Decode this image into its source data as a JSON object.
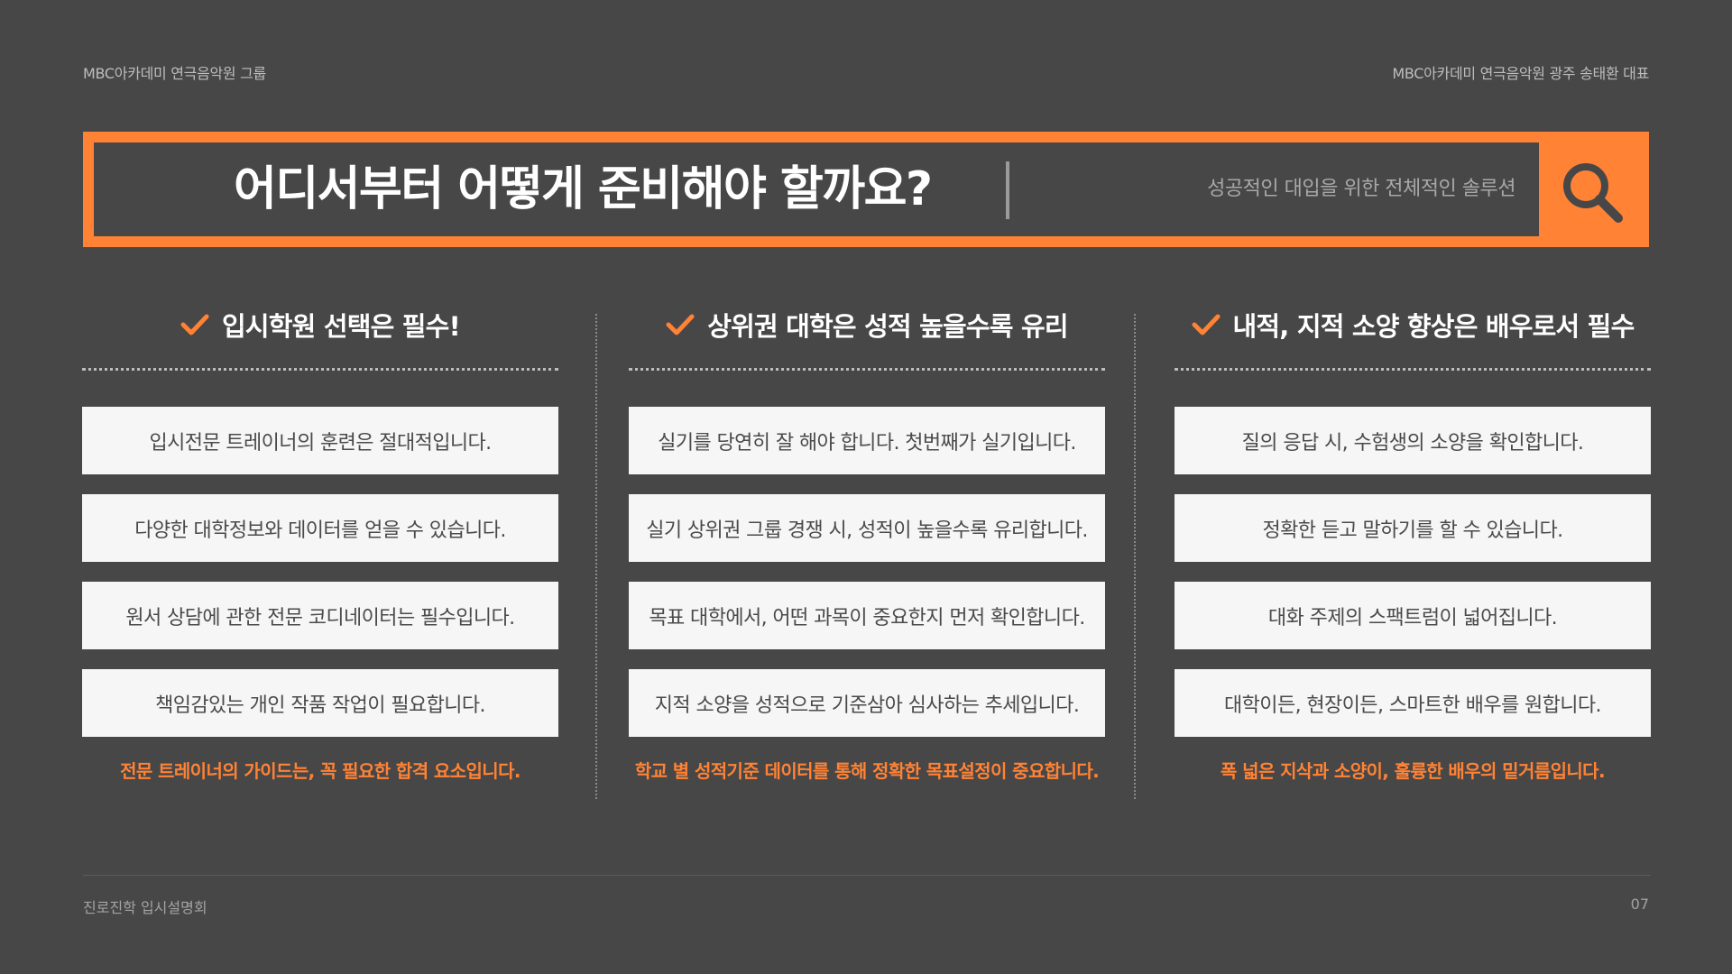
{
  "header": {
    "left_text": "MBC아카데미 연극음악원 그룹",
    "right_text": "MBC아카데미 연극음악원 광주 송태환 대표"
  },
  "search": {
    "query": "어디서부터 어떻게 준비해야 할까요?",
    "hint": "성공적인 대입을 위한 전체적인 솔루션",
    "icon": "search-icon"
  },
  "columns": [
    {
      "title": "입시학원 선택은 필수!",
      "items": [
        "입시전문 트레이너의 훈련은 절대적입니다.",
        "다양한 대학정보와 데이터를 얻을 수 있습니다.",
        "원서 상담에 관한 전문 코디네이터는 필수입니다.",
        "책임감있는 개인 작품 작업이 필요합니다."
      ],
      "note": "전문 트레이너의 가이드는, 꼭 필요한 합격 요소입니다."
    },
    {
      "title": "상위권 대학은 성적 높을수록 유리",
      "items": [
        "실기를 당연히 잘 해야 합니다. 첫번째가 실기입니다.",
        "실기 상위권 그룹 경쟁 시, 성적이 높을수록 유리합니다.",
        "목표 대학에서, 어떤 과목이 중요한지 먼저 확인합니다.",
        "지적 소양을 성적으로 기준삼아 심사하는 추세입니다."
      ],
      "note": "학교 별 성적기준 데이터를 통해 정확한 목표설정이 중요합니다."
    },
    {
      "title": "내적, 지적 소양 향상은 배우로서 필수",
      "items": [
        "질의 응답 시, 수험생의 소양을 확인합니다.",
        "정확한 듣고 말하기를 할 수 있습니다.",
        "대화 주제의 스팩트럼이 넓어집니다.",
        "대학이든, 현장이든, 스마트한 배우를 원합니다."
      ],
      "note": "폭 넓은 지삭과 소양이, 훌륭한 배우의 밑거름입니다."
    }
  ],
  "footer": {
    "left_text": "진로진학 입시설명회",
    "page_number": "07"
  },
  "colors": {
    "background": "#474747",
    "accent": "#ff8235",
    "card": "#f6f6f6",
    "card_text": "#4a4a4a"
  }
}
